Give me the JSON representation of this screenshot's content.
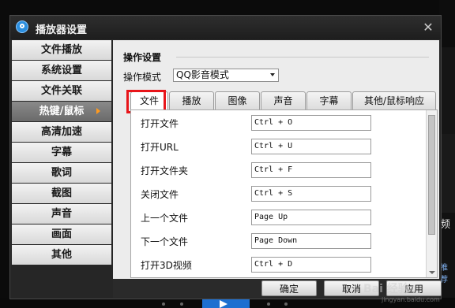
{
  "window": {
    "title": "播放器设置",
    "close_glyph": "✕"
  },
  "sidebar": {
    "items": [
      {
        "label": "文件播放",
        "active": false
      },
      {
        "label": "系统设置",
        "active": false
      },
      {
        "label": "文件关联",
        "active": false
      },
      {
        "label": "热键/鼠标",
        "active": true
      },
      {
        "label": "高清加速",
        "active": false
      },
      {
        "label": "字幕",
        "active": false
      },
      {
        "label": "歌词",
        "active": false
      },
      {
        "label": "截图",
        "active": false
      },
      {
        "label": "声音",
        "active": false
      },
      {
        "label": "画面",
        "active": false
      },
      {
        "label": "其他",
        "active": false
      }
    ]
  },
  "section": {
    "title": "操作设置",
    "mode_label": "操作模式",
    "mode_value": "QQ影音模式"
  },
  "tabs": [
    {
      "label": "文件",
      "active": true
    },
    {
      "label": "播放",
      "active": false
    },
    {
      "label": "图像",
      "active": false
    },
    {
      "label": "声音",
      "active": false
    },
    {
      "label": "字幕",
      "active": false
    },
    {
      "label": "其他/鼠标响应",
      "active": false
    }
  ],
  "hotkeys": [
    {
      "action": "打开文件",
      "key": "Ctrl + O"
    },
    {
      "action": "打开URL",
      "key": "Ctrl + U"
    },
    {
      "action": "打开文件夹",
      "key": "Ctrl + F"
    },
    {
      "action": "关闭文件",
      "key": "Ctrl + S"
    },
    {
      "action": "上一个文件",
      "key": "Page Up"
    },
    {
      "action": "下一个文件",
      "key": "Page Down"
    },
    {
      "action": "打开3D视频",
      "key": "Ctrl + D"
    }
  ],
  "buttons": {
    "ok": "确定",
    "cancel": "取消",
    "apply": "应用"
  },
  "background": {
    "side_text": "频",
    "side_link": "推荐"
  },
  "watermark": {
    "text": "Bai 经验",
    "sub": "jingyan.baidu.com"
  },
  "colors": {
    "highlight": "#e8151a",
    "active_arrow": "#ff9a1f",
    "accent_blue": "#1d6fd0"
  }
}
